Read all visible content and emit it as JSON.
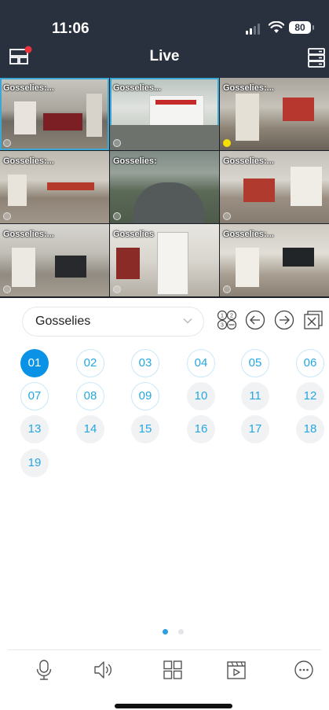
{
  "status_bar": {
    "time": "11:06",
    "battery": "80"
  },
  "header": {
    "title": "Live",
    "left_icon": "device-list-icon",
    "right_icon": "server-icon"
  },
  "cameras": [
    {
      "label": "Gosselies:..."
    },
    {
      "label": "Gosselies..."
    },
    {
      "label": "Gosselies:..."
    },
    {
      "label": "Gosselies:..."
    },
    {
      "label": "Gosselies:"
    },
    {
      "label": "Gosselies:..."
    },
    {
      "label": "Gosselies:..."
    },
    {
      "label": "Gosselies"
    },
    {
      "label": "Gosselies:..."
    }
  ],
  "group": {
    "selected": "Gosselies"
  },
  "controls": {
    "icons": [
      "channel-number-icon",
      "previous-arrow-icon",
      "next-arrow-icon",
      "close-all-icon"
    ]
  },
  "channels": [
    "01",
    "02",
    "03",
    "04",
    "05",
    "06",
    "07",
    "08",
    "09",
    "10",
    "11",
    "12",
    "13",
    "14",
    "15",
    "16",
    "17",
    "18",
    "19"
  ],
  "active_channel": "01",
  "pager": {
    "pages": 2,
    "current": 1
  },
  "toolbar": {
    "icons": [
      "microphone-icon",
      "speaker-icon",
      "grid-layout-icon",
      "playback-icon",
      "more-icon"
    ]
  },
  "colors": {
    "header_bg": "#28313d",
    "accent": "#0a93e6",
    "channel_text": "#26a7e0",
    "selected_tile": "#3aa7d4"
  }
}
